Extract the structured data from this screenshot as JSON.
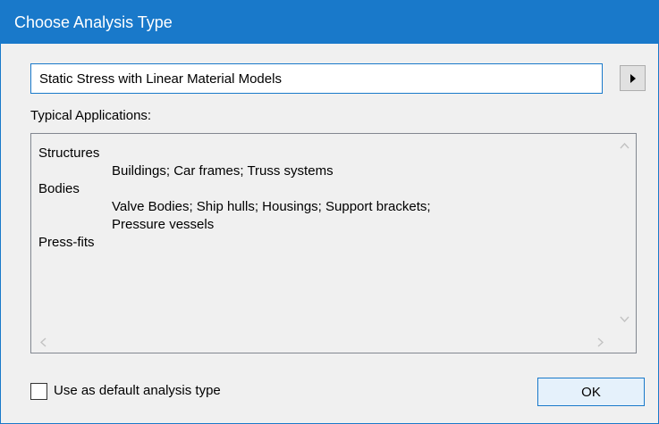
{
  "window": {
    "title": "Choose Analysis Type",
    "accent_color": "#1979ca"
  },
  "analysis_type": {
    "value": "Static Stress with Linear Material Models",
    "menu_button_icon": "triangle-right-icon"
  },
  "typical_applications": {
    "label": "Typical Applications:",
    "lines": [
      {
        "text": "Structures",
        "indent": false
      },
      {
        "text": "Buildings; Car frames; Truss systems",
        "indent": true
      },
      {
        "text": "Bodies",
        "indent": false
      },
      {
        "text": "Valve Bodies; Ship hulls; Housings; Support brackets;",
        "indent": true
      },
      {
        "text": "Pressure vessels",
        "indent": true
      },
      {
        "text": "Press-fits",
        "indent": false
      }
    ]
  },
  "footer": {
    "default_checkbox_label": "Use as default analysis type",
    "default_checked": false,
    "ok_label": "OK"
  }
}
